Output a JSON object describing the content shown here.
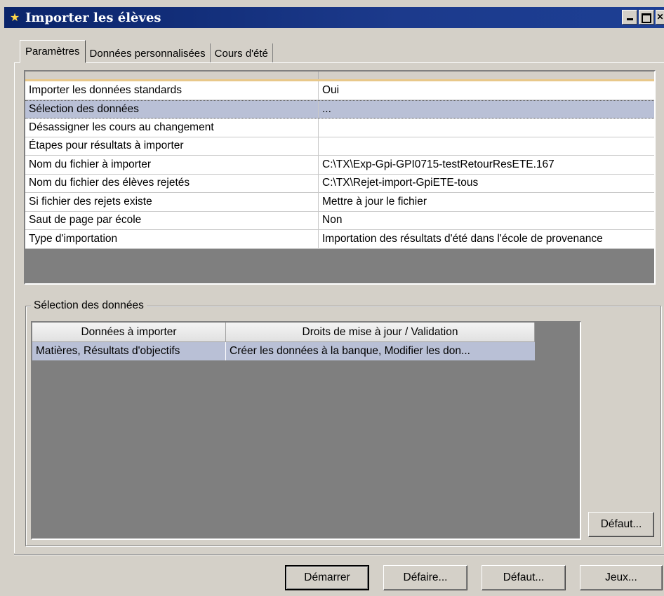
{
  "window": {
    "title": "Importer les élèves",
    "icon": "person-icon"
  },
  "tabs": [
    {
      "label": "Paramètres",
      "active": true
    },
    {
      "label": "Données personnalisées",
      "active": false
    },
    {
      "label": "Cours d'été",
      "active": false
    }
  ],
  "settings": {
    "rows": [
      {
        "name": "Importer les données standards",
        "value": "Oui"
      },
      {
        "name": "Sélection des données",
        "value": "...",
        "selected": true
      },
      {
        "name": "Désassigner les cours au changement",
        "value": ""
      },
      {
        "name": "Étapes pour résultats à importer",
        "value": ""
      },
      {
        "name": "Nom du fichier à importer",
        "value": "C:\\TX\\Exp-Gpi-GPI0715-testRetourResETE.167"
      },
      {
        "name": "Nom du fichier des élèves rejetés",
        "value": "C:\\TX\\Rejet-import-GpiETE-tous"
      },
      {
        "name": "Si fichier des rejets existe",
        "value": "Mettre à jour le fichier"
      },
      {
        "name": "Saut de page par école",
        "value": "Non"
      },
      {
        "name": "Type d'importation",
        "value": "Importation des résultats d'été dans l'école de provenance"
      }
    ]
  },
  "data_selection": {
    "group_label": "Sélection des données",
    "columns": [
      "Données à importer",
      "Droits de mise à jour / Validation"
    ],
    "rows": [
      {
        "data": "Matières, Résultats d'objectifs",
        "rights": "Créer les données à la banque, Modifier les don..."
      }
    ],
    "default_button": "Défaut..."
  },
  "footer": {
    "start": "Démarrer",
    "undo": "Défaire...",
    "default": "Défaut...",
    "sets": "Jeux..."
  }
}
